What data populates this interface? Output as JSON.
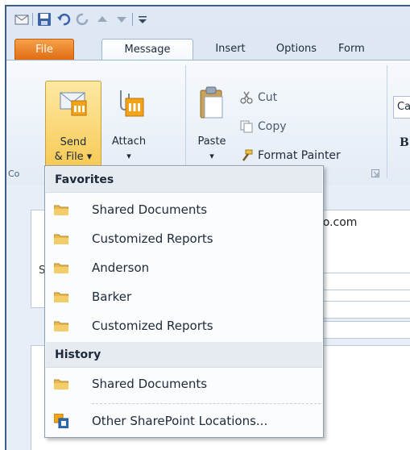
{
  "tabs": {
    "file": "File",
    "message": "Message",
    "insert": "Insert",
    "options": "Options",
    "format_partial": "Form"
  },
  "ribbon": {
    "send_file_line1": "Send",
    "send_file_line2": "& File ▾",
    "attach": "Attach",
    "attach_arrow": "▾",
    "paste": "Paste",
    "paste_arrow": "▾",
    "cut": "Cut",
    "copy": "Copy",
    "format_painter": "Format Painter",
    "font_box_partial": "Ca",
    "bold_partial": "B",
    "group_label_partial": "Co"
  },
  "form": {
    "email_partial": "igo.com",
    "stub_letter": "S"
  },
  "menu": {
    "favorites_header": "Favorites",
    "favorites": [
      "Shared Documents",
      "Customized Reports",
      "Anderson",
      "Barker",
      "Customized Reports"
    ],
    "history_header": "History",
    "history": [
      "Shared Documents"
    ],
    "other_locations": "Other SharePoint Locations..."
  },
  "icons": {
    "folder": "folder-icon",
    "sharepoint": "sharepoint-icon"
  },
  "colors": {
    "file_tab": "#e87820",
    "menu_header_bg": "#e6ebf2",
    "folder": "#e8b84a",
    "send_highlight": "#f7c850"
  }
}
